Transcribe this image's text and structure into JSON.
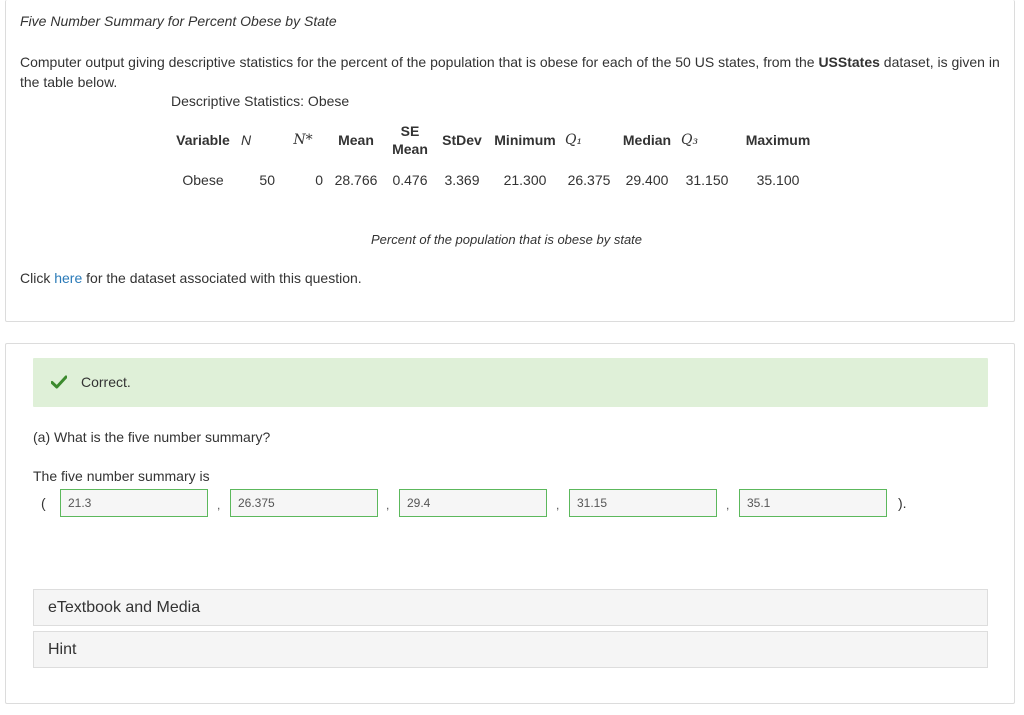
{
  "question": {
    "title": "Five Number Summary for Percent Obese by State",
    "intro_before": "Computer output giving descriptive statistics for the percent of the population that is obese for each of the 50 US states, from the ",
    "intro_bold": "USStates",
    "intro_after": " dataset, is given in the table below.",
    "table_caption": "Descriptive Statistics: Obese",
    "table": {
      "headers": {
        "variable": "Variable",
        "n": "N",
        "nstar": "N*",
        "mean": "Mean",
        "se_mean_1": "SE",
        "se_mean_2": "Mean",
        "stdev": "StDev",
        "minimum": "Minimum",
        "q1": "Q₁",
        "median": "Median",
        "q3": "Q₃",
        "maximum": "Maximum"
      },
      "row": {
        "variable": "Obese",
        "n": "50",
        "nstar": "0",
        "mean": "28.766",
        "se_mean": "0.476",
        "stdev": "3.369",
        "minimum": "21.300",
        "q1": "26.375",
        "median": "29.400",
        "q3": "31.150",
        "maximum": "35.100"
      }
    },
    "image_caption": "Percent of the population that is obese by state",
    "click_before": "Click ",
    "click_link": "here",
    "click_after": " for the dataset associated with this question."
  },
  "answer": {
    "status": "Correct.",
    "status_color": "#dff0d8",
    "check_color": "#3c8a2e",
    "part_a": "(a) What is the five number summary?",
    "summary_label": "The five number summary is",
    "open_paren": "(",
    "close_paren": ").",
    "comma": ",",
    "values": [
      "21.3",
      "26.375",
      "29.4",
      "31.15",
      "35.1"
    ],
    "accordions": [
      "eTextbook and Media",
      "Hint"
    ]
  }
}
